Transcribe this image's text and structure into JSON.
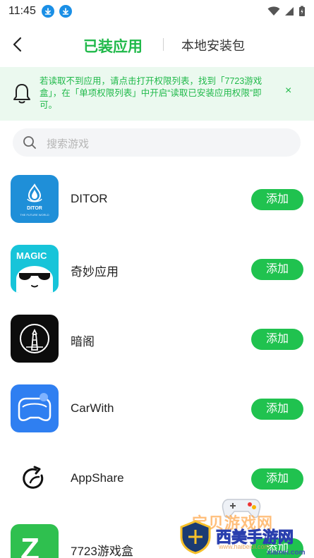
{
  "status_bar": {
    "time": "11:45"
  },
  "header": {
    "tab_installed": "已装应用",
    "tab_local": "本地安装包"
  },
  "notice": {
    "text": "若读取不到应用，请点击打开权限列表，找到「7723游戏盒」，在「单项权限列表」中开启“读取已安装应用权限”即可。",
    "close": "×"
  },
  "search": {
    "placeholder": "搜索游戏"
  },
  "apps": [
    {
      "name": "DITOR",
      "add_label": "添加",
      "logo_text": "DITOR",
      "logo_sub": "THE FUTURE WORLD"
    },
    {
      "name": "奇妙应用",
      "add_label": "添加",
      "logo_text": "MAGIC"
    },
    {
      "name": "暗阁",
      "add_label": "添加"
    },
    {
      "name": "CarWith",
      "add_label": "添加"
    },
    {
      "name": "AppShare",
      "add_label": "添加"
    },
    {
      "name": "7723游戏盒",
      "add_label": "添加",
      "logo_text": "Z"
    }
  ],
  "watermark": {
    "line1": "宝贝游戏网",
    "line2": "西美手游网",
    "url": "www.haibeiol.com",
    "site": "xiamei.com"
  },
  "colors": {
    "accent": "#20b94a",
    "button": "#20c24f",
    "notice_bg": "#ebf9ef"
  }
}
